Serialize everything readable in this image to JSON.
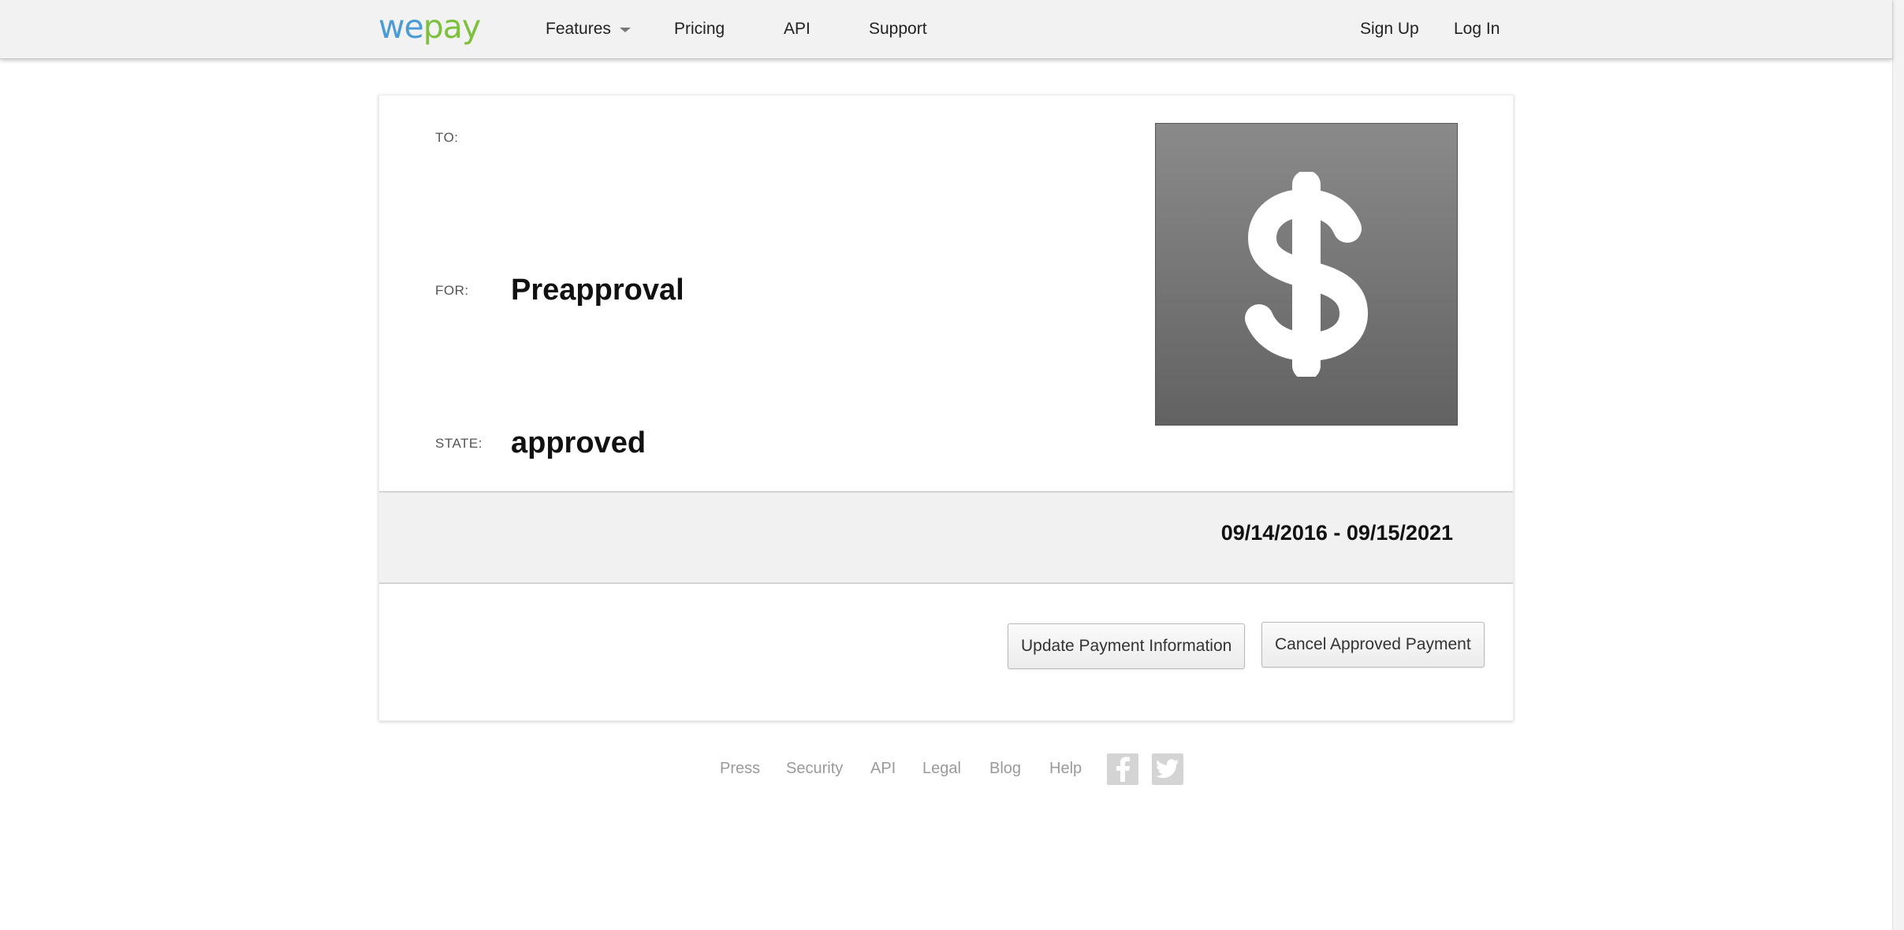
{
  "header": {
    "logo_we": "we",
    "logo_pay": "pay",
    "nav": {
      "features": "Features",
      "pricing": "Pricing",
      "api": "API",
      "support": "Support"
    },
    "sign_up": "Sign Up",
    "log_in": "Log In"
  },
  "card": {
    "to_label": "TO:",
    "to_value": "",
    "for_label": "FOR:",
    "for_value": "Preapproval",
    "state_label": "STATE:",
    "state_value": "approved",
    "image_icon": "dollar-sign-icon",
    "date_range": "09/14/2016 - 09/15/2021",
    "update_button": "Update Payment Information",
    "cancel_button": "Cancel Approved Payment"
  },
  "footer": {
    "links": [
      "Press",
      "Security",
      "API",
      "Legal",
      "Blog",
      "Help"
    ],
    "social_icons": [
      "facebook-icon",
      "twitter-icon"
    ]
  },
  "colors": {
    "logo_we": "#4b9bd5",
    "logo_pay": "#7cc03c",
    "header_bg": "#f2f2f2",
    "band_bg": "#f1f1f1",
    "icon_tile": "#767676"
  }
}
